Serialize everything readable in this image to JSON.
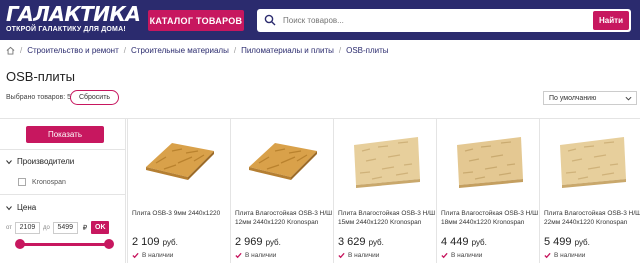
{
  "header": {
    "logo_main": "ГАЛАКТИКА",
    "logo_sub": "ОТКРОЙ ГАЛАКТИКУ ДЛЯ ДОМА!",
    "catalog_button": "КАТАЛОГ ТОВАРОВ",
    "search_placeholder": "Поиск товаров...",
    "search_button": "Найти",
    "colors": {
      "bar": "#2b2b6e",
      "accent": "#c7175f"
    }
  },
  "breadcrumb": {
    "items": [
      "Строительство и ремонт",
      "Строительные материалы",
      "Пиломатериалы и плиты",
      "OSB-плиты"
    ]
  },
  "page": {
    "title": "OSB-плиты",
    "selected_count": "Выбрано товаров: 5",
    "reset_button": "Сбросить",
    "sort_value": "По умолчанию"
  },
  "filters": {
    "show_button": "Показать",
    "manufacturers_label": "Производители",
    "manufacturer_option": "Kronospan",
    "price_label": "Цена",
    "price_from_label": "от",
    "price_from": "2109",
    "price_to_label": "до",
    "price_to": "5499",
    "currency": "₽",
    "ok_button": "OK"
  },
  "products": [
    {
      "name": "Плита OSB-3 9мм 2440х1220",
      "price": "2 109",
      "currency": "руб.",
      "stock": "В наличии"
    },
    {
      "name": "Плита Влагостойкая OSB-3 Н/Ш 12мм 2440х1220 Kronospan",
      "price": "2 969",
      "currency": "руб.",
      "stock": "В наличии"
    },
    {
      "name": "Плита Влагостойкая OSB-3 Н/Ш 15мм 2440х1220 Kronospan",
      "price": "3 629",
      "currency": "руб.",
      "stock": "В наличии"
    },
    {
      "name": "Плита Влагостойкая OSB-3 Н/Ш 18мм 2440х1220 Kronospan",
      "price": "4 449",
      "currency": "руб.",
      "stock": "В наличии"
    },
    {
      "name": "Плита Влагостойкая OSB-3 Н/Ш 22мм 2440х1220 Kronospan",
      "price": "5 499",
      "currency": "руб.",
      "stock": "В наличии"
    }
  ]
}
